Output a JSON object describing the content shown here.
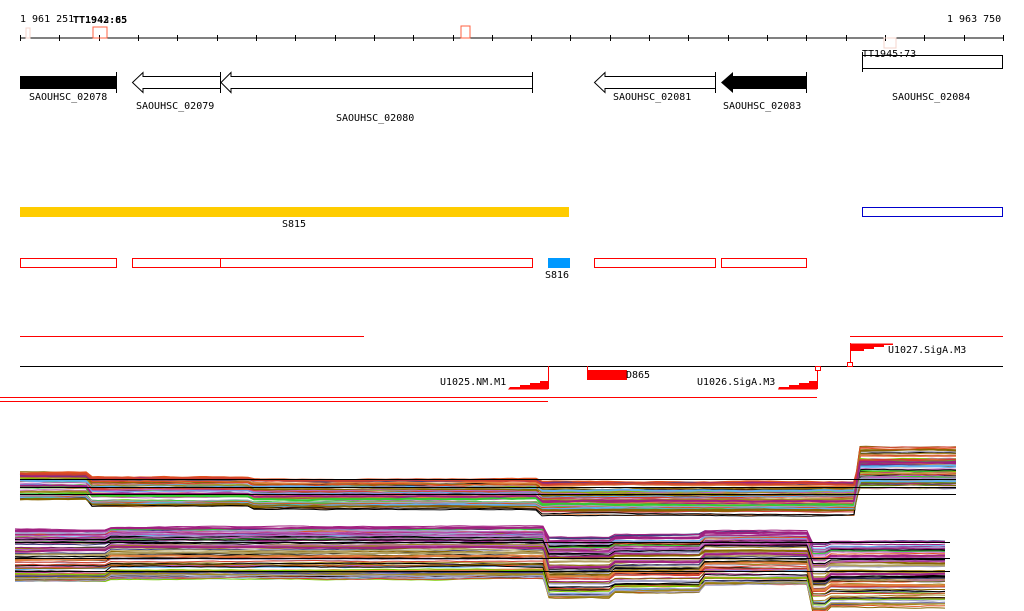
{
  "ruler": {
    "start": "1 961 251",
    "end": "1 963 750",
    "tick_count": 26
  },
  "terminators": [
    {
      "label": "TT1943:85",
      "overlay_label": "TT1942:65"
    },
    {
      "label": "TT1945:73"
    }
  ],
  "genes": [
    {
      "name": "SAOUHSC_02078",
      "strand": "+",
      "style": "filled"
    },
    {
      "name": "SAOUHSC_02079",
      "strand": "-",
      "style": "outline"
    },
    {
      "name": "SAOUHSC_02080",
      "strand": "-",
      "style": "outline"
    },
    {
      "name": "SAOUHSC_02081",
      "strand": "-",
      "style": "outline"
    },
    {
      "name": "SAOUHSC_02083",
      "strand": "-",
      "style": "filled"
    },
    {
      "name": "SAOUHSC_02084",
      "strand": "+",
      "style": "outline"
    }
  ],
  "segments": [
    {
      "name": "S815",
      "color": "#ffcc00"
    },
    {
      "name": "S816",
      "color": "#0099ff"
    }
  ],
  "features": [
    {
      "name": "U1025.NM.M1",
      "color": "#ff0000"
    },
    {
      "name": "D865",
      "color": "#ff0000"
    },
    {
      "name": "U1026.SigA.M3",
      "color": "#ff0000"
    },
    {
      "name": "U1027.SigA.M3",
      "color": "#ff0000"
    }
  ],
  "profile_colors": [
    "#000000",
    "#e05020",
    "#7ccc00",
    "#a0a0c8",
    "#a02080",
    "#60b0f0",
    "#a08820",
    "#d04030",
    "#886600",
    "#33cc33",
    "#c060c0",
    "#e08040",
    "#404080",
    "#b0a060"
  ]
}
